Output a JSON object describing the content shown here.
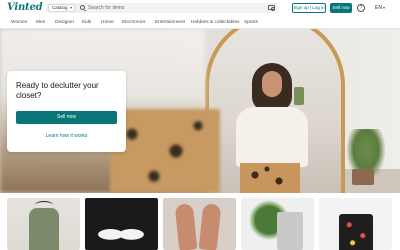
{
  "brand": {
    "logo": "Vinted",
    "accent": "#09777a"
  },
  "search": {
    "category": "Catalog",
    "placeholder": "Search for items"
  },
  "header": {
    "login_label": "Sign up | Log in",
    "sell_label": "Sell now",
    "language": "EN"
  },
  "categories": [
    "Women",
    "Men",
    "Designer",
    "Kids",
    "Home",
    "Electronics",
    "Entertainment",
    "Hobbies & collectables",
    "Sports"
  ],
  "hero": {
    "title": "Ready to declutter your closet?",
    "cta_label": "Sell now",
    "link_label": "Learn how it works"
  },
  "listings": [
    "cardigan",
    "bra",
    "heels",
    "plant",
    "floral-garment"
  ]
}
